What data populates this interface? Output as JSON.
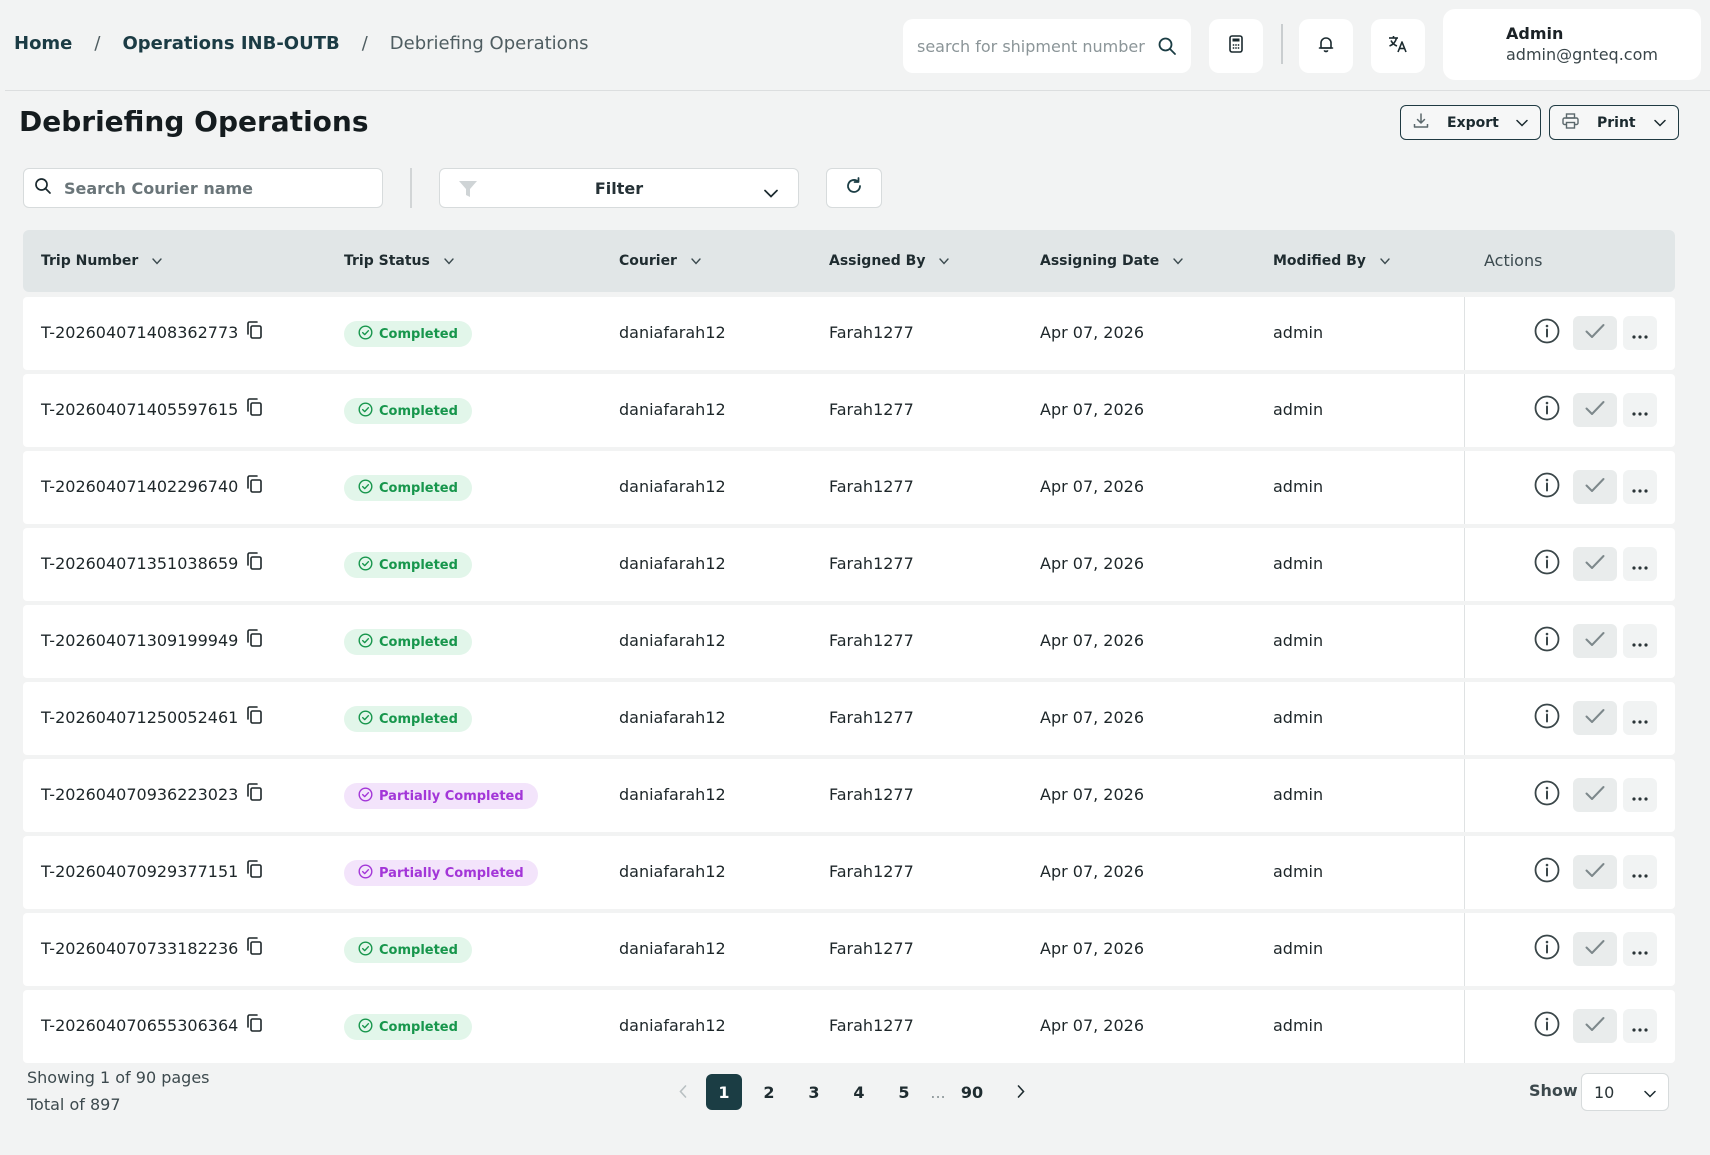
{
  "breadcrumb": {
    "home": "Home",
    "section": "Operations INB-OUTB",
    "current": "Debriefing Operations",
    "separator": "/"
  },
  "header": {
    "search_placeholder": "search for shipment number",
    "icons": [
      "calculator-icon",
      "bell-icon",
      "translate-icon"
    ],
    "user": {
      "name": "Admin",
      "email": "admin@gnteq.com"
    }
  },
  "page": {
    "title": "Debriefing Operations",
    "export_label": "Export",
    "print_label": "Print"
  },
  "toolbar": {
    "courier_search_placeholder": "Search Courier name",
    "filter_label": "Filter"
  },
  "table": {
    "columns": [
      "Trip Number",
      "Trip Status",
      "Courier",
      "Assigned By",
      "Assigning Date",
      "Modified By",
      "Actions"
    ],
    "rows": [
      {
        "trip": "T-202604071408362773",
        "status": "Completed",
        "courier": "daniafarah12",
        "assigned_by": "Farah1277",
        "date": "Apr 07, 2026",
        "modified_by": "admin"
      },
      {
        "trip": "T-202604071405597615",
        "status": "Completed",
        "courier": "daniafarah12",
        "assigned_by": "Farah1277",
        "date": "Apr 07, 2026",
        "modified_by": "admin"
      },
      {
        "trip": "T-202604071402296740",
        "status": "Completed",
        "courier": "daniafarah12",
        "assigned_by": "Farah1277",
        "date": "Apr 07, 2026",
        "modified_by": "admin"
      },
      {
        "trip": "T-202604071351038659",
        "status": "Completed",
        "courier": "daniafarah12",
        "assigned_by": "Farah1277",
        "date": "Apr 07, 2026",
        "modified_by": "admin"
      },
      {
        "trip": "T-202604071309199949",
        "status": "Completed",
        "courier": "daniafarah12",
        "assigned_by": "Farah1277",
        "date": "Apr 07, 2026",
        "modified_by": "admin"
      },
      {
        "trip": "T-202604071250052461",
        "status": "Completed",
        "courier": "daniafarah12",
        "assigned_by": "Farah1277",
        "date": "Apr 07, 2026",
        "modified_by": "admin"
      },
      {
        "trip": "T-202604070936223023",
        "status": "Partially Completed",
        "courier": "daniafarah12",
        "assigned_by": "Farah1277",
        "date": "Apr 07, 2026",
        "modified_by": "admin"
      },
      {
        "trip": "T-202604070929377151",
        "status": "Partially Completed",
        "courier": "daniafarah12",
        "assigned_by": "Farah1277",
        "date": "Apr 07, 2026",
        "modified_by": "admin"
      },
      {
        "trip": "T-202604070733182236",
        "status": "Completed",
        "courier": "daniafarah12",
        "assigned_by": "Farah1277",
        "date": "Apr 07, 2026",
        "modified_by": "admin"
      },
      {
        "trip": "T-202604070655306364",
        "status": "Completed",
        "courier": "daniafarah12",
        "assigned_by": "Farah1277",
        "date": "Apr 07, 2026",
        "modified_by": "admin"
      }
    ]
  },
  "footer": {
    "showing": "Showing 1 of 90 pages",
    "total": "Total of 897",
    "pages": [
      "1",
      "2",
      "3",
      "4",
      "5"
    ],
    "ellipsis": "...",
    "last_page": "90",
    "current_page": "1",
    "show_label": "Show",
    "page_size": "10"
  },
  "colors": {
    "primary": "#1b3d44",
    "completed_bg": "#e2f6ea",
    "completed_text": "#17964c",
    "partial_bg": "#f3e4fb",
    "partial_text": "#a336d8"
  }
}
